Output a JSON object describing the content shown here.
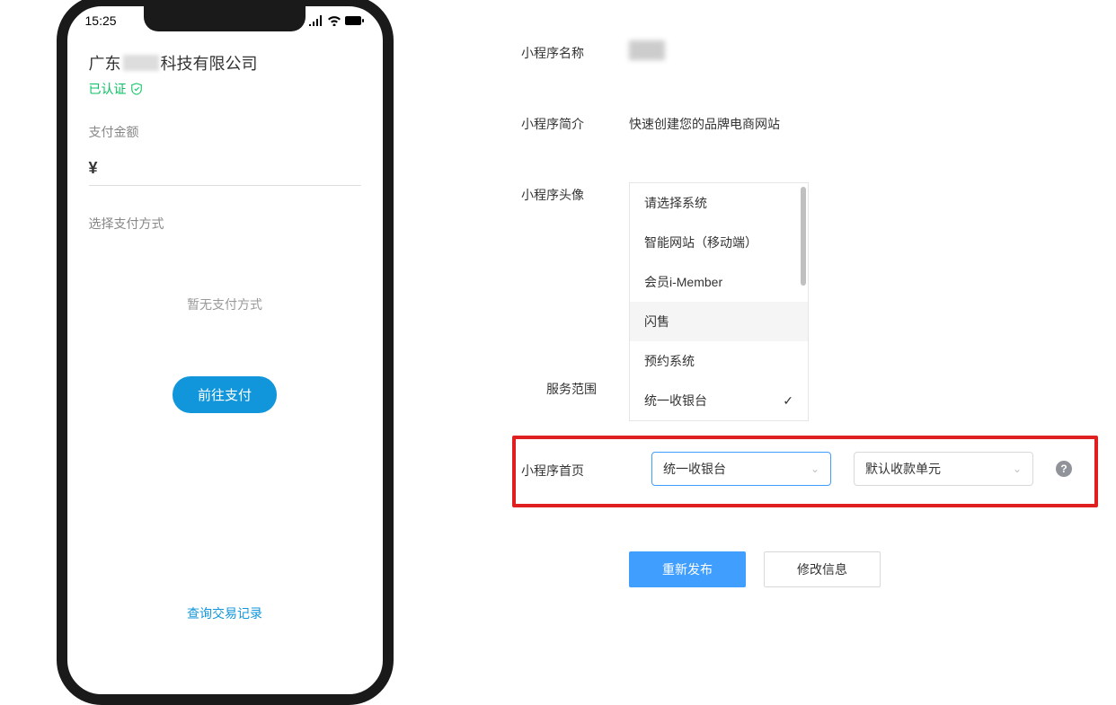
{
  "phone": {
    "status_time": "15:25",
    "company_prefix": "广东",
    "company_suffix": "科技有限公司",
    "verified_label": "已认证",
    "amount_label": "支付金额",
    "currency_symbol": "¥",
    "payment_method_label": "选择支付方式",
    "no_payment_text": "暂无支付方式",
    "pay_button_label": "前往支付",
    "query_link_label": "查询交易记录"
  },
  "form": {
    "app_name_label": "小程序名称",
    "intro_label": "小程序简介",
    "intro_value": "快速创建您的品牌电商网站",
    "avatar_label": "小程序头像",
    "dropdown_options": [
      "请选择系统",
      "智能网站（移动端）",
      "会员i-Member",
      "闪售",
      "预约系统",
      "统一收银台"
    ],
    "service_scope_label": "服务范围",
    "homepage_label": "小程序首页",
    "select1_value": "统一收银台",
    "select2_value": "默认收款单元",
    "republish_label": "重新发布",
    "modify_label": "修改信息"
  }
}
